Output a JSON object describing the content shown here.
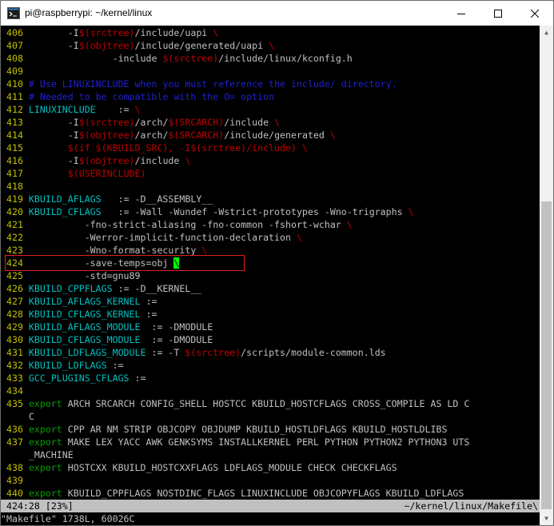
{
  "window": {
    "title": "pi@raspberrypi: ~/kernel/linux",
    "icons": {
      "app": "terminal-icon",
      "minimize": "minimize-icon",
      "maximize": "maximize-icon",
      "close": "close-icon"
    }
  },
  "colors": {
    "background": "#000000",
    "line_number": "#c0c000",
    "identifier": "#00c0c0",
    "comment": "#2020d0",
    "dollar": "#c00000",
    "keyword": "#00a000",
    "text": "#c0c0c0",
    "cursor": "#00ff00",
    "highlight_box": "#e02020"
  },
  "editor": {
    "lines": [
      {
        "n": " 406",
        "segs": [
          [
            "w",
            "        -I"
          ],
          [
            "d",
            "$(srctree)"
          ],
          [
            "w",
            "/include/uapi "
          ],
          [
            "b",
            "\\"
          ]
        ]
      },
      {
        "n": " 407",
        "segs": [
          [
            "w",
            "        -I"
          ],
          [
            "d",
            "$(objtree)"
          ],
          [
            "w",
            "/include/generated/uapi "
          ],
          [
            "b",
            "\\"
          ]
        ]
      },
      {
        "n": " 408",
        "segs": [
          [
            "w",
            "                -include "
          ],
          [
            "d",
            "$(srctree)"
          ],
          [
            "w",
            "/include/linux/kconfig.h"
          ]
        ]
      },
      {
        "n": " 409",
        "segs": []
      },
      {
        "n": " 410",
        "segs": [
          [
            "c",
            " # Use LINUXINCLUDE when you must reference the include/ directory."
          ]
        ]
      },
      {
        "n": " 411",
        "segs": [
          [
            "c",
            " # Needed to be compatible with the O= option"
          ]
        ]
      },
      {
        "n": " 412",
        "segs": [
          [
            "i",
            " LINUXINCLUDE"
          ],
          [
            "w",
            "    := "
          ],
          [
            "b",
            "\\"
          ]
        ]
      },
      {
        "n": " 413",
        "segs": [
          [
            "w",
            "        -I"
          ],
          [
            "d",
            "$(srctree)"
          ],
          [
            "w",
            "/arch/"
          ],
          [
            "d",
            "$(SRCARCH)"
          ],
          [
            "w",
            "/include "
          ],
          [
            "b",
            "\\"
          ]
        ]
      },
      {
        "n": " 414",
        "segs": [
          [
            "w",
            "        -I"
          ],
          [
            "d",
            "$(objtree)"
          ],
          [
            "w",
            "/arch/"
          ],
          [
            "d",
            "$(SRCARCH)"
          ],
          [
            "w",
            "/include/generated "
          ],
          [
            "b",
            "\\"
          ]
        ]
      },
      {
        "n": " 415",
        "segs": [
          [
            "w",
            "        "
          ],
          [
            "d",
            "$(if $(KBUILD_SRC), -I$(srctree)/include)"
          ],
          [
            "w",
            " "
          ],
          [
            "b",
            "\\"
          ]
        ]
      },
      {
        "n": " 416",
        "segs": [
          [
            "w",
            "        -I"
          ],
          [
            "d",
            "$(objtree)"
          ],
          [
            "w",
            "/include "
          ],
          [
            "b",
            "\\"
          ]
        ]
      },
      {
        "n": " 417",
        "segs": [
          [
            "w",
            "        "
          ],
          [
            "d",
            "$(USERINCLUDE)"
          ]
        ]
      },
      {
        "n": " 418",
        "segs": []
      },
      {
        "n": " 419",
        "segs": [
          [
            "i",
            " KBUILD_AFLAGS"
          ],
          [
            "w",
            "   := -D__ASSEMBLY__"
          ]
        ]
      },
      {
        "n": " 420",
        "segs": [
          [
            "i",
            " KBUILD_CFLAGS"
          ],
          [
            "w",
            "   := -Wall -Wundef -Wstrict-prototypes -Wno-trigraphs "
          ],
          [
            "b",
            "\\"
          ]
        ]
      },
      {
        "n": " 421",
        "segs": [
          [
            "w",
            "           -fno-strict-aliasing -fno-common -fshort-wchar "
          ],
          [
            "b",
            "\\"
          ]
        ]
      },
      {
        "n": " 422",
        "segs": [
          [
            "w",
            "           -Werror-implicit-function-declaration "
          ],
          [
            "b",
            "\\"
          ]
        ]
      },
      {
        "n": " 423",
        "segs": [
          [
            "w",
            "           -Wno-format-security "
          ],
          [
            "b",
            "\\"
          ]
        ]
      },
      {
        "n": " 424",
        "segs": [
          [
            "w",
            "           -save-temps=obj "
          ],
          [
            "k",
            "\\"
          ]
        ]
      },
      {
        "n": " 425",
        "segs": [
          [
            "w",
            "           -std=gnu89"
          ]
        ]
      },
      {
        "n": " 426",
        "segs": [
          [
            "i",
            " KBUILD_CPPFLAGS"
          ],
          [
            "w",
            " := -D__KERNEL__"
          ]
        ]
      },
      {
        "n": " 427",
        "segs": [
          [
            "i",
            " KBUILD_AFLAGS_KERNEL"
          ],
          [
            "w",
            " :="
          ]
        ]
      },
      {
        "n": " 428",
        "segs": [
          [
            "i",
            " KBUILD_CFLAGS_KERNEL"
          ],
          [
            "w",
            " :="
          ]
        ]
      },
      {
        "n": " 429",
        "segs": [
          [
            "i",
            " KBUILD_AFLAGS_MODULE"
          ],
          [
            "w",
            "  := -DMODULE"
          ]
        ]
      },
      {
        "n": " 430",
        "segs": [
          [
            "i",
            " KBUILD_CFLAGS_MODULE"
          ],
          [
            "w",
            "  := -DMODULE"
          ]
        ]
      },
      {
        "n": " 431",
        "segs": [
          [
            "i",
            " KBUILD_LDFLAGS_MODULE"
          ],
          [
            "w",
            " := -T "
          ],
          [
            "d",
            "$(srctree)"
          ],
          [
            "w",
            "/scripts/module-common.lds"
          ]
        ]
      },
      {
        "n": " 432",
        "segs": [
          [
            "i",
            " KBUILD_LDFLAGS"
          ],
          [
            "w",
            " :="
          ]
        ]
      },
      {
        "n": " 433",
        "segs": [
          [
            "i",
            " GCC_PLUGINS_CFLAGS"
          ],
          [
            "w",
            " :="
          ]
        ]
      },
      {
        "n": " 434",
        "segs": []
      },
      {
        "n": " 435",
        "segs": [
          [
            "g",
            " export"
          ],
          [
            "w",
            " ARCH SRCARCH CONFIG_SHELL HOSTCC KBUILD_HOSTCFLAGS CROSS_COMPILE AS LD C"
          ]
        ]
      },
      {
        "n": "    ",
        "segs": [
          [
            "w",
            " C"
          ]
        ]
      },
      {
        "n": " 436",
        "segs": [
          [
            "g",
            " export"
          ],
          [
            "w",
            " CPP AR NM STRIP OBJCOPY OBJDUMP KBUILD_HOSTLDFLAGS KBUILD_HOSTLDLIBS"
          ]
        ]
      },
      {
        "n": " 437",
        "segs": [
          [
            "g",
            " export"
          ],
          [
            "w",
            " MAKE LEX YACC AWK GENKSYMS INSTALLKERNEL PERL PYTHON PYTHON2 PYTHON3 UTS"
          ]
        ]
      },
      {
        "n": "    ",
        "segs": [
          [
            "w",
            " _MACHINE"
          ]
        ]
      },
      {
        "n": " 438",
        "segs": [
          [
            "g",
            " export"
          ],
          [
            "w",
            " HOSTCXX KBUILD_HOSTCXXFLAGS LDFLAGS_MODULE CHECK CHECKFLAGS"
          ]
        ]
      },
      {
        "n": " 439",
        "segs": []
      },
      {
        "n": " 440",
        "segs": [
          [
            "g",
            " export"
          ],
          [
            "w",
            " KBUILD_CPPFLAGS NOSTDINC_FLAGS LINUXINCLUDE OBJCOPYFLAGS KBUILD_LDFLAGS"
          ]
        ]
      }
    ],
    "status": {
      "position": " 424:28 [23%]",
      "filepath": "~/kernel/linux/Makefile\\"
    },
    "cmdline": "\"Makefile\" 1738L, 60026C"
  }
}
